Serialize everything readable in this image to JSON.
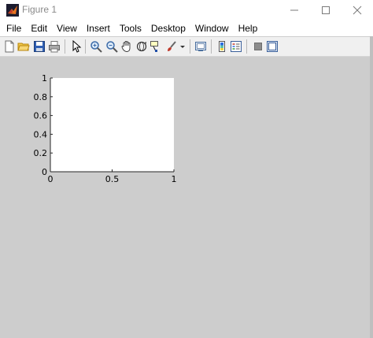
{
  "window": {
    "title": "Figure 1",
    "minimize_icon": "minimize-icon",
    "maximize_icon": "maximize-icon",
    "close_icon": "close-icon"
  },
  "menubar": {
    "items": [
      "File",
      "Edit",
      "View",
      "Insert",
      "Tools",
      "Desktop",
      "Window",
      "Help"
    ]
  },
  "toolbar": {
    "buttons": [
      "new-figure-icon",
      "open-file-icon",
      "save-icon",
      "print-icon",
      "edit-plot-arrow-icon",
      "zoom-in-icon",
      "zoom-out-icon",
      "pan-hand-icon",
      "rotate-3d-icon",
      "data-cursor-icon",
      "brush-icon",
      "brush-dropdown-icon",
      "link-plot-icon",
      "insert-colorbar-icon",
      "insert-legend-icon",
      "hide-plot-tools-icon",
      "show-plot-tools-icon"
    ]
  },
  "chart_data": {
    "type": "line",
    "series": [],
    "xlim": [
      0,
      1
    ],
    "ylim": [
      0,
      1
    ],
    "xticks": [
      "0",
      "0.5",
      "1"
    ],
    "yticks": [
      "0",
      "0.2",
      "0.4",
      "0.6",
      "0.8",
      "1"
    ],
    "title": "",
    "xlabel": "",
    "ylabel": "",
    "grid": false
  },
  "colors": {
    "figure_background": "#cdcdcd",
    "axes_background": "#ffffff",
    "toolbar_background": "#f0f0f0"
  }
}
